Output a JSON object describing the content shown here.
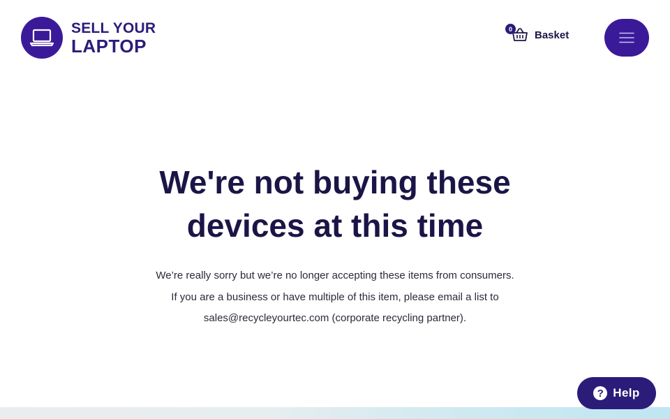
{
  "header": {
    "logo": {
      "line1": "SELL YOUR",
      "line2": "LAPTOP",
      "icon": "laptop-icon"
    },
    "basket": {
      "count": "0",
      "label": "Basket",
      "icon": "basket-icon"
    },
    "menu": {
      "icon": "hamburger-icon"
    }
  },
  "main": {
    "title": "We're not buying these devices at this time",
    "description": "We’re really sorry but we’re no longer accepting these items from consumers. If you are a business or have multiple of this item, please email a list to sales@recycleyourtec.com (corporate recycling partner)."
  },
  "help": {
    "label": "Help",
    "icon_glyph": "?",
    "icon": "question-circle-icon"
  },
  "colors": {
    "brand": "#3b1a9a",
    "brand_dark": "#2b1c7a",
    "heading": "#1b1547"
  }
}
